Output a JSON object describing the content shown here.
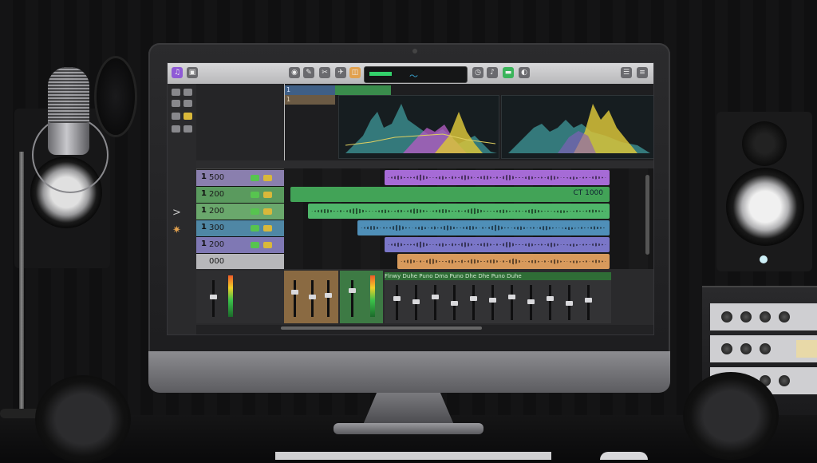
{
  "toolbar": {
    "lcd_meter_color": "#33d16b",
    "lcd_wave_icon": "waveform-icon"
  },
  "upper": {
    "region_top_label": "1",
    "region_label": "1"
  },
  "tracks": [
    {
      "num": "1",
      "name": "500",
      "color": "#8a7fae"
    },
    {
      "num": "1",
      "name": "200",
      "color": "#5a9a5e"
    },
    {
      "num": "1",
      "name": "200",
      "color": "#6aa86c"
    },
    {
      "num": "1",
      "name": "300",
      "color": "#4f87a5"
    },
    {
      "num": "1",
      "name": "200",
      "color": "#7f78b4"
    },
    {
      "num": "",
      "name": "000",
      "color": "#b7b7ba"
    }
  ],
  "regions": {
    "green_label": "CT 1000",
    "colors": {
      "purple": "#a66bd6",
      "green": "#42a357",
      "green_light": "#4fb66a",
      "blue": "#4f8fb8",
      "violet": "#7a76c8",
      "orange": "#d89a5c"
    }
  },
  "mixer": {
    "fx_labels": "Flnwy  Duhe  Puno  Dma  Puno  Dhe  Dhe  Puno  Duhe"
  }
}
